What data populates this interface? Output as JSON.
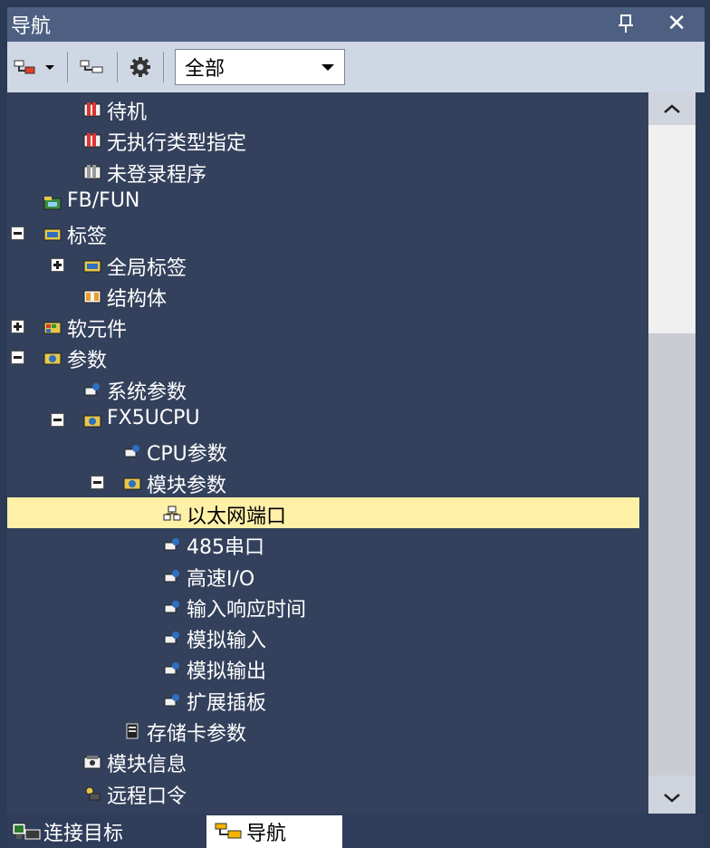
{
  "window": {
    "title": "导航"
  },
  "toolbar": {
    "filter_value": "全部"
  },
  "tree": [
    {
      "label": "待机",
      "indent": 1,
      "expander": null,
      "icon": "module-red-icon"
    },
    {
      "label": "无执行类型指定",
      "indent": 1,
      "expander": null,
      "icon": "module-red-icon"
    },
    {
      "label": "未登录程序",
      "indent": 1,
      "expander": null,
      "icon": "module-gray-icon"
    },
    {
      "label": "FB/FUN",
      "indent": 0,
      "expander": null,
      "icon": "fb-folder-icon"
    },
    {
      "label": "标签",
      "indent": 0,
      "expander": "minus",
      "icon": "label-folder-icon"
    },
    {
      "label": "全局标签",
      "indent": 1,
      "expander": "plus",
      "icon": "label-folder-icon"
    },
    {
      "label": "结构体",
      "indent": 1,
      "expander": null,
      "icon": "struct-icon"
    },
    {
      "label": "软元件",
      "indent": 0,
      "expander": "plus",
      "icon": "device-folder-icon"
    },
    {
      "label": "参数",
      "indent": 0,
      "expander": "minus",
      "icon": "param-folder-icon"
    },
    {
      "label": "系统参数",
      "indent": 1,
      "expander": null,
      "icon": "param-icon"
    },
    {
      "label": "FX5UCPU",
      "indent": 1,
      "expander": "minus",
      "icon": "param-folder-icon"
    },
    {
      "label": "CPU参数",
      "indent": 2,
      "expander": null,
      "icon": "param-icon"
    },
    {
      "label": "模块参数",
      "indent": 2,
      "expander": "minus",
      "icon": "param-folder-icon"
    },
    {
      "label": "以太网端口",
      "indent": 3,
      "expander": null,
      "icon": "network-icon",
      "selected": true
    },
    {
      "label": "485串口",
      "indent": 3,
      "expander": null,
      "icon": "param-icon"
    },
    {
      "label": "高速I/O",
      "indent": 3,
      "expander": null,
      "icon": "param-icon"
    },
    {
      "label": "输入响应时间",
      "indent": 3,
      "expander": null,
      "icon": "param-icon"
    },
    {
      "label": "模拟输入",
      "indent": 3,
      "expander": null,
      "icon": "param-icon"
    },
    {
      "label": "模拟输出",
      "indent": 3,
      "expander": null,
      "icon": "param-icon"
    },
    {
      "label": "扩展插板",
      "indent": 3,
      "expander": null,
      "icon": "param-icon"
    },
    {
      "label": "存储卡参数",
      "indent": 2,
      "expander": null,
      "icon": "memory-card-icon"
    },
    {
      "label": "模块信息",
      "indent": 1,
      "expander": null,
      "icon": "module-info-icon"
    },
    {
      "label": "远程口令",
      "indent": 1,
      "expander": null,
      "icon": "remote-password-icon"
    }
  ],
  "bottom_tabs": [
    {
      "label": "连接目标",
      "icon": "connection-target-icon",
      "active": false
    },
    {
      "label": "导航",
      "icon": "navigation-icon",
      "active": true
    }
  ]
}
